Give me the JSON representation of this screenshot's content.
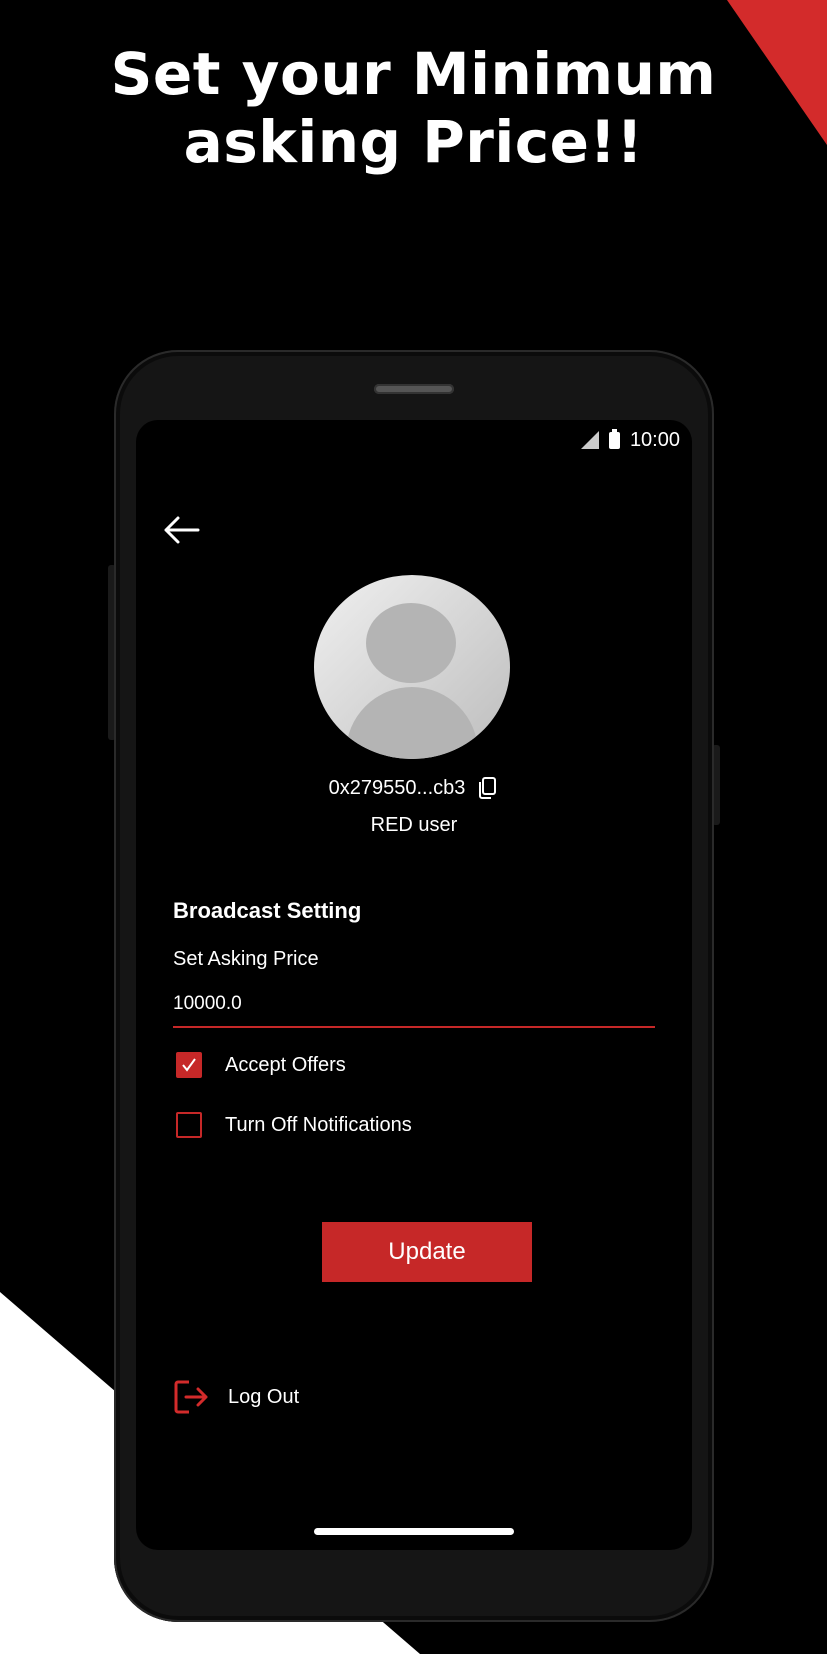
{
  "promo": {
    "headline_line1": "Set your Minimum",
    "headline_line2": "asking Price!!"
  },
  "status_bar": {
    "time": "10:00"
  },
  "profile": {
    "address": "0x279550...cb3",
    "role": "RED user"
  },
  "broadcast": {
    "title": "Broadcast Setting",
    "asking_price_label": "Set Asking Price",
    "asking_price_value": "10000.0",
    "accept_offers_label": "Accept Offers",
    "accept_offers_checked": true,
    "notifications_off_label": "Turn Off Notifications",
    "notifications_off_checked": false,
    "update_label": "Update"
  },
  "logout": {
    "label": "Log Out"
  },
  "colors": {
    "accent": "#c62828",
    "background": "#000000",
    "text": "#ffffff"
  }
}
